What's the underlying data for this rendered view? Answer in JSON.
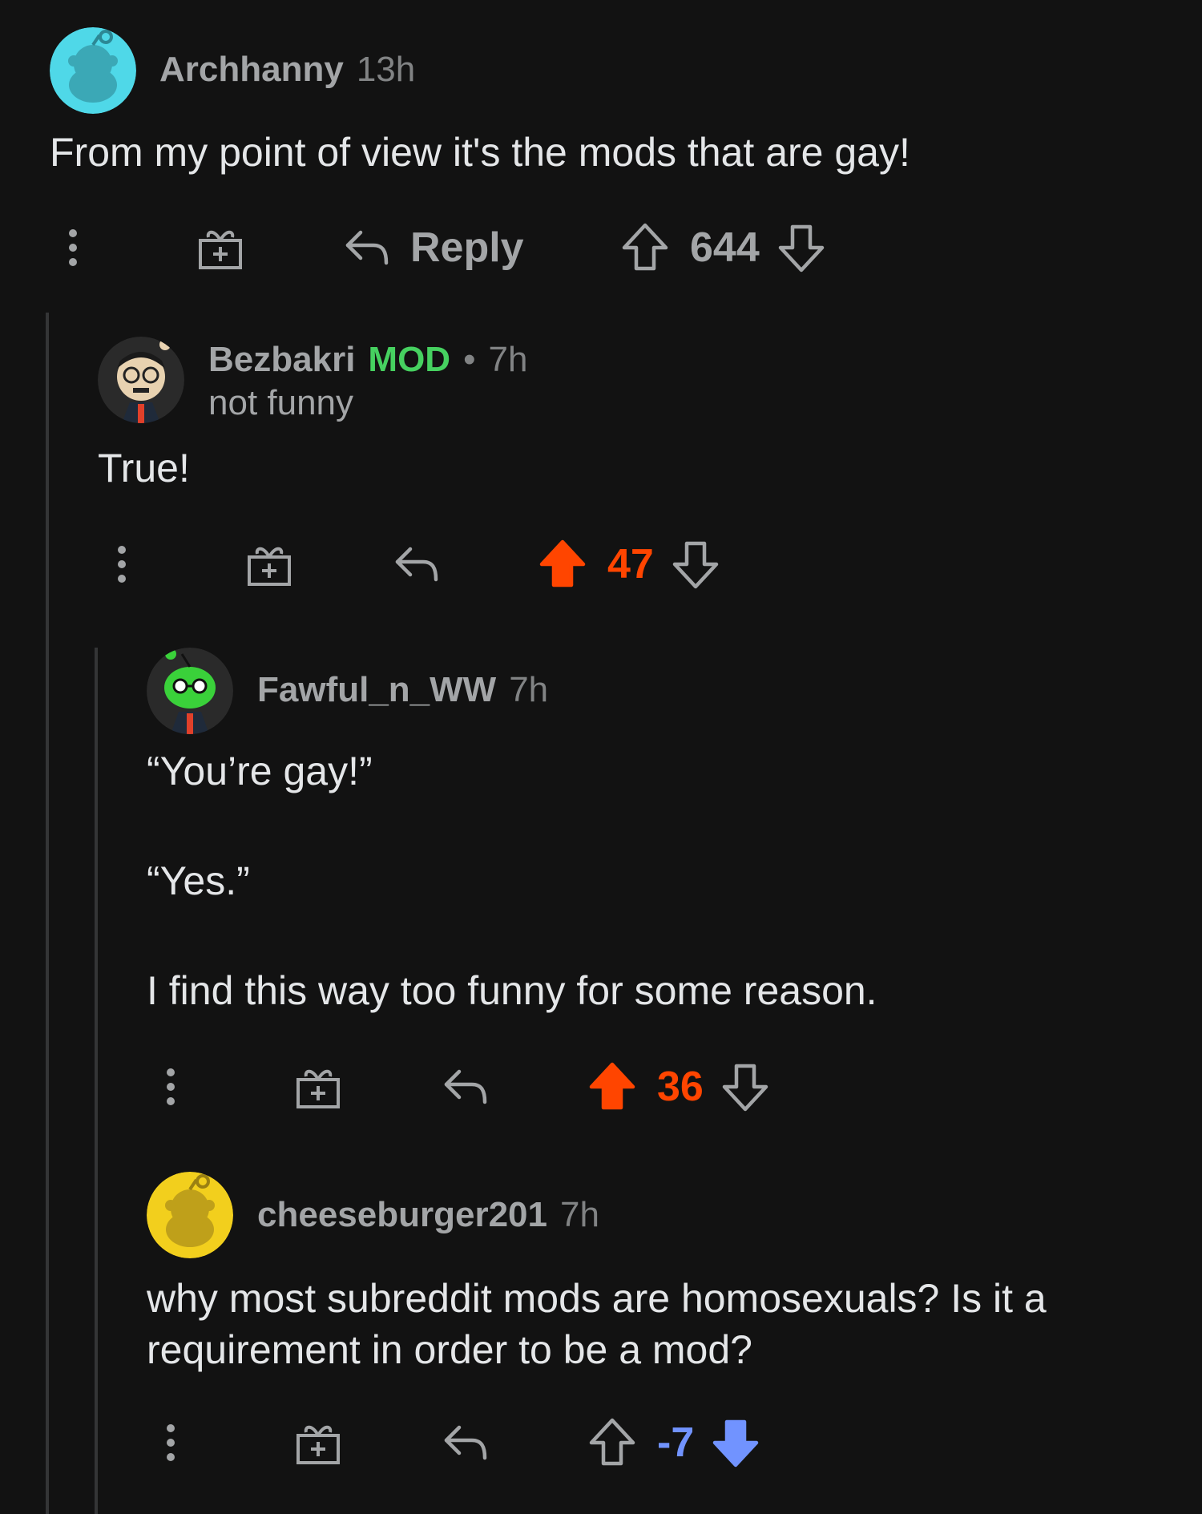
{
  "colors": {
    "background": "#121212",
    "upvoted": "#ff4500",
    "downvoted": "#7193ff",
    "mod": "#46d160",
    "muted": "#818384"
  },
  "comments": [
    {
      "username": "Archhanny",
      "time": "13h",
      "body": [
        "From my point of view it's the mods that are gay!"
      ],
      "reply_label": "Reply",
      "score": "644",
      "vote_state": "none",
      "avatar_icon": "snoo-avatar-cyan-icon"
    },
    {
      "username": "Bezbakri",
      "badge": "MOD",
      "separator": "•",
      "time": "7h",
      "flair": "not funny",
      "body": [
        "True!"
      ],
      "score": "47",
      "vote_state": "up",
      "avatar_icon": "custom-avatar-glasses-icon"
    },
    {
      "username": "Fawful_n_WW",
      "time": "7h",
      "body": [
        "“You’re gay!”",
        "“Yes.”",
        "I find this way too funny for some reason."
      ],
      "score": "36",
      "vote_state": "up",
      "avatar_icon": "custom-avatar-green-icon"
    },
    {
      "username": "cheeseburger201",
      "time": "7h",
      "body": [
        "why most subreddit mods are homosexuals? Is it a requirement in order to be a mod?"
      ],
      "score": "-7",
      "vote_state": "down",
      "avatar_icon": "snoo-avatar-yellow-icon"
    }
  ]
}
